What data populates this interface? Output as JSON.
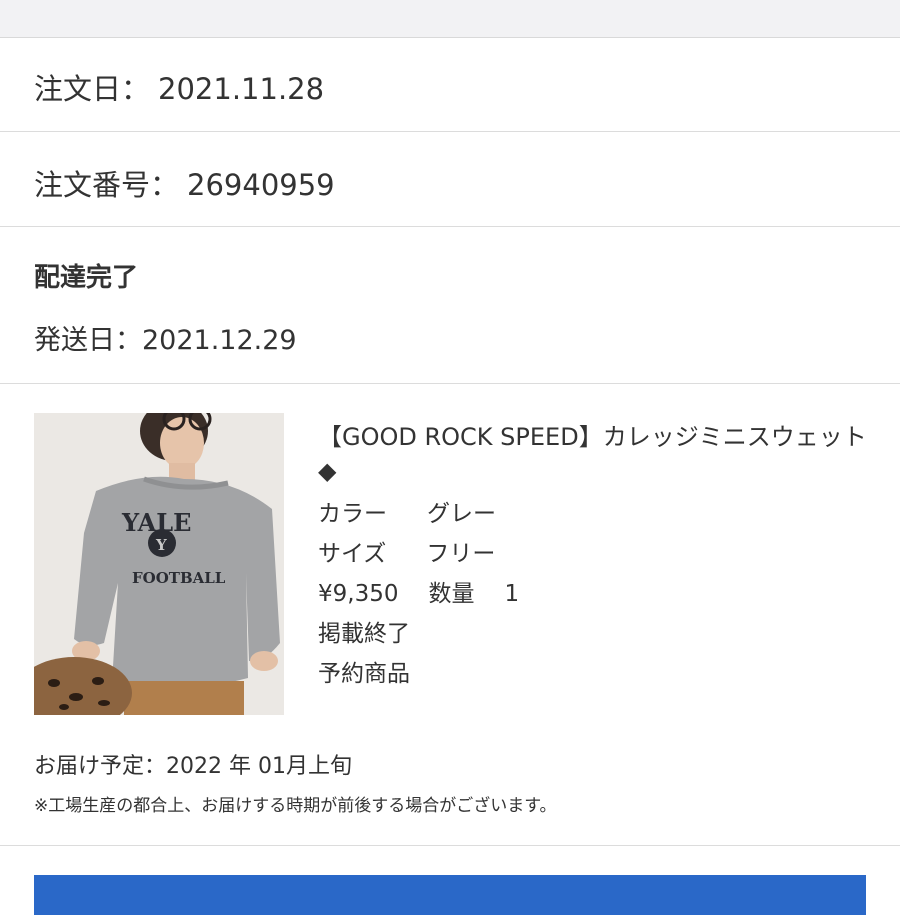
{
  "order": {
    "date_label": "注文日：",
    "date_value": "2021.11.28",
    "number_label": "注文番号：",
    "number_value": "26940959"
  },
  "shipment": {
    "status": "配達完了",
    "ship_date": "発送日：2021.12.29"
  },
  "product": {
    "image_alt": "model wearing grey YALE FOOTBALL sweatshirt",
    "print_line1": "YALE",
    "print_letter": "Y",
    "print_line2": "FOOTBALL",
    "name": "【GOOD ROCK SPEED】カレッジミニスウェット◆",
    "color_label": "カラー",
    "color_value": "グレー",
    "size_label": "サイズ",
    "size_value": "フリー",
    "price": "¥9,350",
    "qty_label": "数量",
    "qty_value": "1",
    "listing_status": "掲載終了",
    "order_type": "予約商品"
  },
  "delivery": {
    "schedule": "お届け予定：2022 年 01月上旬",
    "note": "※工場生産の都合上、お届けする時期が前後する場合がございます。"
  },
  "colors": {
    "accent": "#2a68c8",
    "divider": "#dcdcdc",
    "text": "#333333"
  }
}
